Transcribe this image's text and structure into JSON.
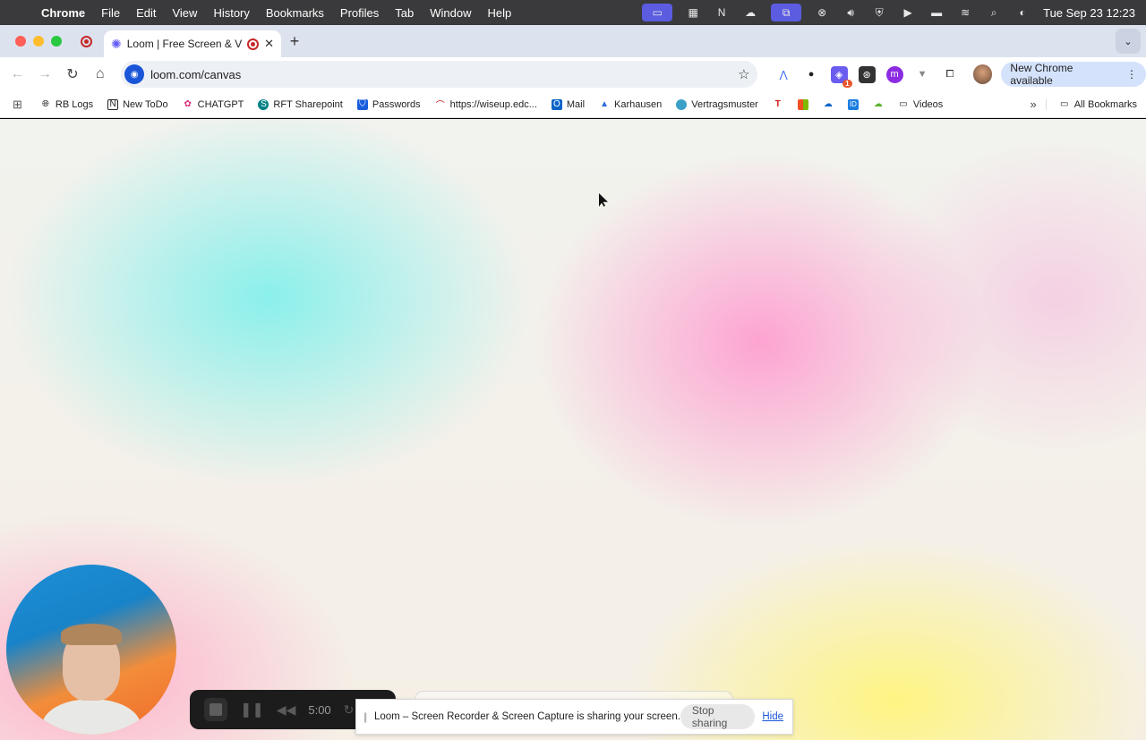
{
  "menubar": {
    "app_name": "Chrome",
    "items": [
      "File",
      "Edit",
      "View",
      "History",
      "Bookmarks",
      "Profiles",
      "Tab",
      "Window",
      "Help"
    ],
    "clock": "Tue Sep 23  12:23"
  },
  "tabs": [
    {
      "title": "Loom | Free Screen & Vid"
    }
  ],
  "toolbar": {
    "url": "loom.com/canvas",
    "update_label": "New Chrome available",
    "ext_badge": "1"
  },
  "bookmarks": {
    "items": [
      {
        "label": "RB Logs",
        "icon": "globe-icon"
      },
      {
        "label": "New ToDo",
        "icon": "notion-icon"
      },
      {
        "label": "CHATGPT",
        "icon": "copilot-icon"
      },
      {
        "label": "RFT Sharepoint",
        "icon": "sharepoint-icon"
      },
      {
        "label": "Passwords",
        "icon": "bitwarden-icon"
      },
      {
        "label": "https://wiseup.edc...",
        "icon": "wiseup-icon"
      },
      {
        "label": "Mail",
        "icon": "outlook-icon"
      },
      {
        "label": "Karhausen",
        "icon": "karhausen-icon"
      },
      {
        "label": "Vertragsmuster",
        "icon": "vertragsmuster-icon"
      }
    ],
    "folder": "Videos",
    "all_bookmarks": "All Bookmarks"
  },
  "loom_controls": {
    "timer": "5:00"
  },
  "share_notice": {
    "message": "Loom – Screen Recorder & Screen Capture is sharing your screen.",
    "stop_label": "Stop sharing",
    "hide_label": "Hide"
  },
  "colors": {
    "menubar_bg": "#3a3a3c",
    "tabstrip_bg": "#dde3ee",
    "update_button_bg": "#d4e2fb",
    "link_blue": "#1a55d8",
    "loom_bar_bg": "#1c1c1c"
  }
}
